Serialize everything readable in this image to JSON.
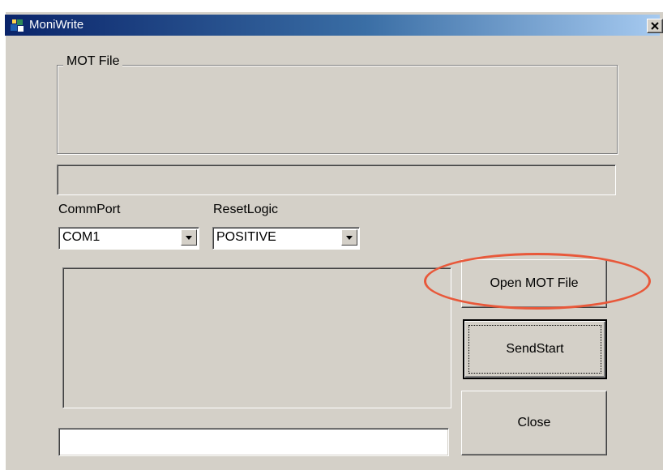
{
  "window": {
    "title": "MoniWrite",
    "title_icon": "app-icon",
    "close_icon": "close-icon",
    "close_glyph": "✕"
  },
  "mot_group": {
    "legend": "MOT File",
    "path_value": ""
  },
  "comm_port": {
    "label": "CommPort",
    "selected": "COM1"
  },
  "reset_logic": {
    "label": "ResetLogic",
    "selected": "POSITIVE"
  },
  "log": {
    "text": ""
  },
  "status": {
    "text": ""
  },
  "buttons": {
    "open_mot": "Open MOT File",
    "send_start": "SendStart",
    "close": "Close"
  },
  "annotation": {
    "color": "#e8583a"
  }
}
